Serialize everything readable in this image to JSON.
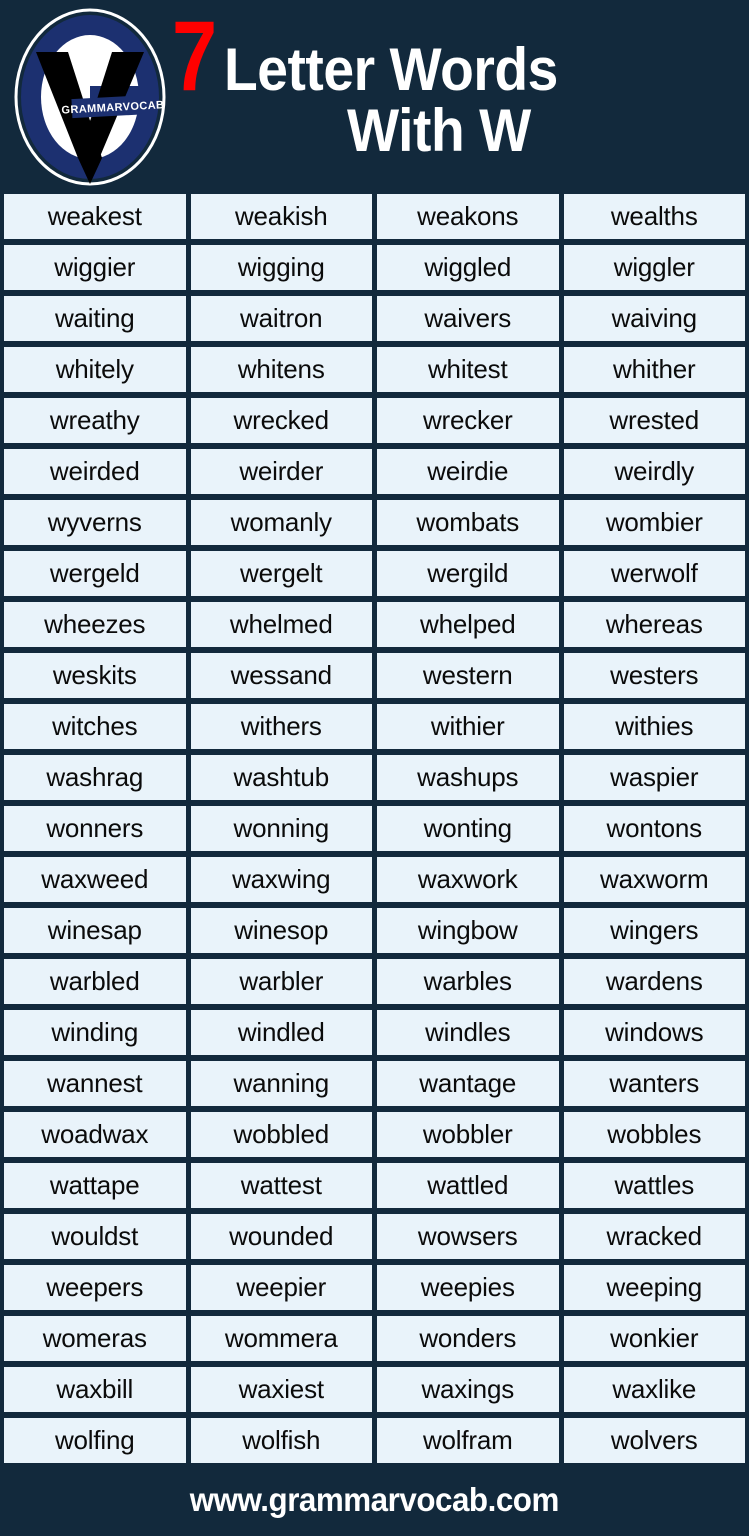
{
  "colors": {
    "background": "#12293c",
    "cell_background": "#e9f3fa",
    "cell_text": "#0b0b0b",
    "accent_red": "#ff0000",
    "title_text": "#ffffff",
    "logo_navy": "#1c3070",
    "logo_white": "#ffffff",
    "logo_black": "#000000"
  },
  "header": {
    "logo": {
      "icon_name": "grammarvocab-logo",
      "badge_text": "GRAMMARVOCAB"
    },
    "title_number": "7",
    "title_main": "Letter Words",
    "title_sub": "With W"
  },
  "grid": {
    "columns": 4,
    "rows": 25,
    "words": [
      [
        "weakest",
        "weakish",
        "weakons",
        "wealths"
      ],
      [
        "wiggier",
        "wigging",
        "wiggled",
        "wiggler"
      ],
      [
        "waiting",
        "waitron",
        "waivers",
        "waiving"
      ],
      [
        "whitely",
        "whitens",
        "whitest",
        "whither"
      ],
      [
        "wreathy",
        "wrecked",
        "wrecker",
        "wrested"
      ],
      [
        "weirded",
        "weirder",
        "weirdie",
        "weirdly"
      ],
      [
        "wyverns",
        "womanly",
        "wombats",
        "wombier"
      ],
      [
        "wergeld",
        "wergelt",
        "wergild",
        "werwolf"
      ],
      [
        "wheezes",
        "whelmed",
        "whelped",
        "whereas"
      ],
      [
        "weskits",
        "wessand",
        "western",
        "westers"
      ],
      [
        "witches",
        "withers",
        "withier",
        "withies"
      ],
      [
        "washrag",
        "washtub",
        "washups",
        "waspier"
      ],
      [
        "wonners",
        "wonning",
        "wonting",
        "wontons"
      ],
      [
        "waxweed",
        "waxwing",
        "waxwork",
        "waxworm"
      ],
      [
        "winesap",
        "winesop",
        "wingbow",
        "wingers"
      ],
      [
        "warbled",
        "warbler",
        "warbles",
        "wardens"
      ],
      [
        "winding",
        "windled",
        "windles",
        "windows"
      ],
      [
        "wannest",
        "wanning",
        "wantage",
        "wanters"
      ],
      [
        "woadwax",
        "wobbled",
        "wobbler",
        "wobbles"
      ],
      [
        "wattape",
        "wattest",
        "wattled",
        "wattles"
      ],
      [
        "wouldst",
        "wounded",
        "wowsers",
        "wracked"
      ],
      [
        "weepers",
        "weepier",
        "weepies",
        "weeping"
      ],
      [
        "womeras",
        "wommera",
        "wonders",
        "wonkier"
      ],
      [
        "waxbill",
        "waxiest",
        "waxings",
        "waxlike"
      ],
      [
        "wolfing",
        "wolfish",
        "wolfram",
        "wolvers"
      ]
    ]
  },
  "footer": {
    "website": "www.grammarvocab.com"
  }
}
